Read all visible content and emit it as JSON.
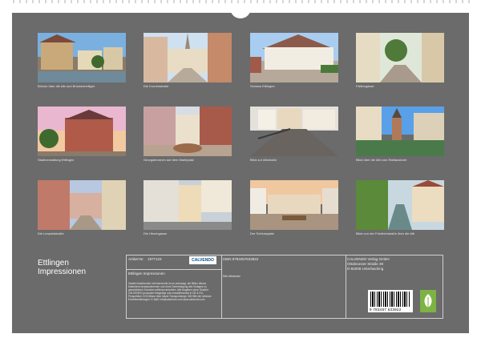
{
  "calendar": {
    "title_line1": "Ettlingen",
    "title_line2": "Impressionen"
  },
  "photos": [
    {
      "caption": "Brücke über die Alb und Brückenheiliger"
    },
    {
      "caption": "Die Kronenstraße"
    },
    {
      "caption": "Schloss Ettlingen"
    },
    {
      "caption": "Färbergasse"
    },
    {
      "caption": "Stadtverwaltung Ettlingen"
    },
    {
      "caption": "Georgsbrunnen auf dem Marktplatz"
    },
    {
      "caption": "Blick zur Albstraße"
    },
    {
      "caption": "Blick über die Alb zum Rathausturm"
    },
    {
      "caption": "Die Leopoldstraße"
    },
    {
      "caption": "Die Hirschgasse"
    },
    {
      "caption": "Der Schlossplatz"
    },
    {
      "caption": "Blick von der Friedrichstraße über die Alb"
    }
  ],
  "info": {
    "article_label": "Artikel-Nr.",
    "article_no": "1977123",
    "isbn": "ISBN 9783457633922",
    "calendar_title": "Ettlingen Impressionen",
    "author": "Dirk Meutzner",
    "publisher_line1": "CALVENDO Verlag GmbH",
    "publisher_line2": "Ottobrunner Straße 39",
    "publisher_line3": "D-82008 Unterhaching",
    "legal_text": "Inhalte bestehender Urheberrechte ist es untersagt, die Bilder dieses Kalenders herauszutrennen und ohne Genehmigung des Verlages zu gewerblichen Zwecken weiterzuverbreiten. Alle Angaben ohne Gewähr. CALVENDO produziert festgelegt und umweltbewusst in DE & EU. Prospektion CO2-Bilanz über lokale Transportwege. Mit Hilfe der Adresse Einzelbestellungen. E-Mail: info@calvendo.com www.calvendo.com",
    "logo_text": "CALVENDO",
    "barcode_number": "9 783457 633922"
  },
  "colors": {
    "background": "#6b6b6b",
    "accent_green": "#7cb342"
  }
}
